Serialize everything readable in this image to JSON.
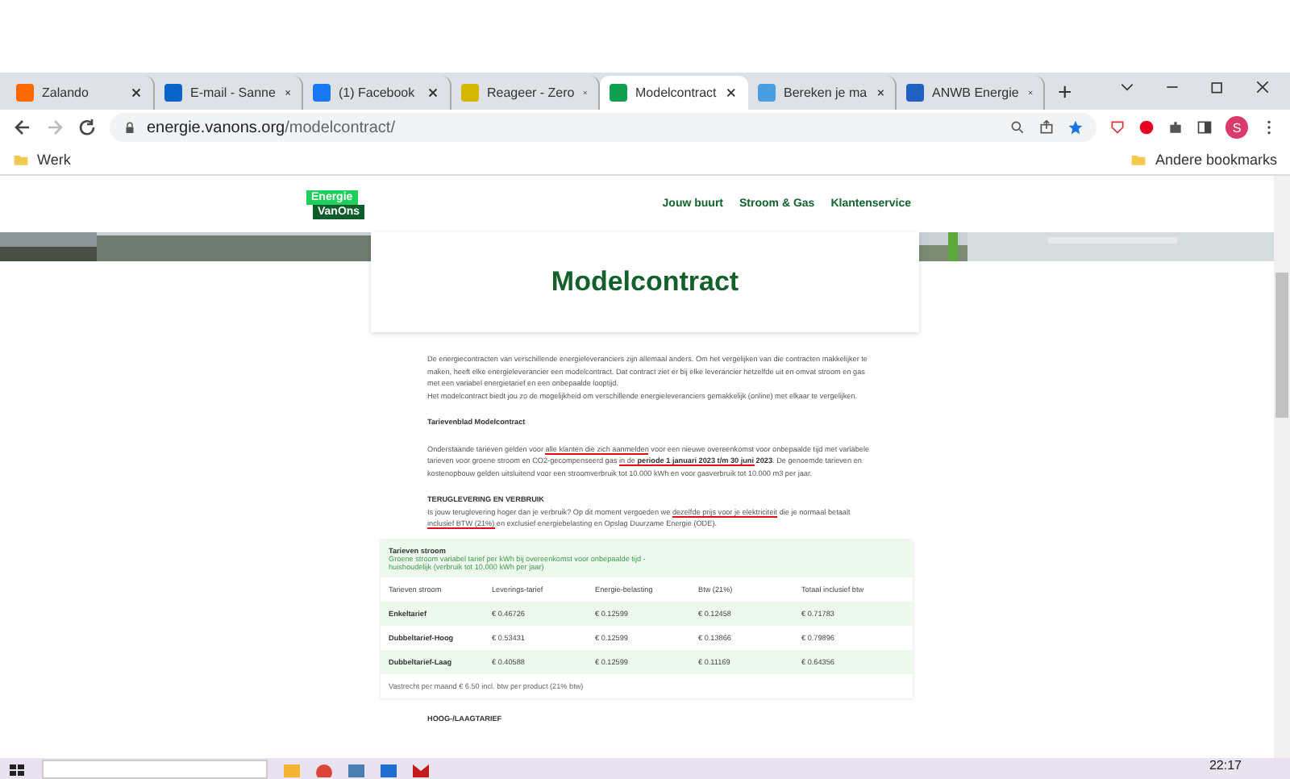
{
  "browser": {
    "tabs": [
      {
        "title": "Zalando",
        "selected": false,
        "color": "#ff6900"
      },
      {
        "title": "E-mail - Sanne",
        "selected": false,
        "color": "#0a64c8"
      },
      {
        "title": "(1) Facebook",
        "selected": false,
        "color": "#1877f2"
      },
      {
        "title": "Reageer - Zero",
        "selected": false,
        "color": "#d4b800"
      },
      {
        "title": "Modelcontract",
        "selected": true,
        "color": "#10a050"
      },
      {
        "title": "Bereken je ma",
        "selected": false,
        "color": "#4a9ee0"
      },
      {
        "title": "ANWB Energie",
        "selected": false,
        "color": "#2060c0"
      }
    ],
    "new_tab": "+",
    "url_host": "energie.vanons.org",
    "url_path": "/modelcontract/",
    "bookmarks": [
      "Werk"
    ],
    "other_bookmarks": "Andere bookmarks",
    "profile": "S"
  },
  "page": {
    "logo": {
      "top": "Energie",
      "bottom": "VanOns"
    },
    "nav": [
      "Jouw buurt",
      "Stroom & Gas",
      "Klantenservice"
    ],
    "title": "Modelcontract",
    "blocks": [
      {
        "kind": "paragraph",
        "segments": [
          {
            "text": "De energiecontracten van verschillende energieleveranciers zijn allemaal anders. Om het vergelijken van die contracten makkelijker te maken, heeft elke energieleverancier een modelcontract. Dat contract ziet er bij elke leverancier hetzelfde uit en omvat stroom en gas met een variabel energietarief en een onbepaalde looptijd.",
            "bold": false,
            "underlined": false
          }
        ]
      },
      {
        "kind": "continuation",
        "segments": [
          {
            "text": "Het modelcontract biedt jou zo de mogelijkheid om verschillende energieleveranciers gemakkelijk (online) met elkaar te vergelijken.",
            "bold": false,
            "underlined": false
          }
        ]
      },
      {
        "kind": "heading",
        "segments": [
          {
            "text": "Tarievenblad Modelcontract",
            "bold": true,
            "underlined": false
          }
        ]
      },
      {
        "kind": "paragraph",
        "segments": [
          {
            "text": "Onderstaande tarieven gelden voor ",
            "bold": false,
            "underlined": false
          },
          {
            "text": "alle klanten die zich aanmelden",
            "bold": false,
            "underlined": true
          },
          {
            "text": " voor een nieuwe overeenkomst voor onbepaalde tijd met variabele tarieven voor groene stroom en CO2-gecompenseerd gas ",
            "bold": false,
            "underlined": false
          },
          {
            "text": "in de ",
            "bold": false,
            "underlined": true
          },
          {
            "text": "periode 1 januari 2023 t/m 30 juni",
            "bold": true,
            "underlined": true
          },
          {
            "text": " 2023",
            "bold": true,
            "underlined": false
          },
          {
            "text": ". De genoemde tarieven en kostenopbouw gelden uitsluitend voor een stroomverbruik tot 10.000 kWh en voor gasverbruik tot 10.000 m3 per jaar.",
            "bold": false,
            "underlined": false
          }
        ]
      },
      {
        "kind": "heading",
        "segments": [
          {
            "text": "TERUGLEVERING EN VERBRUIK",
            "bold": true,
            "underlined": false
          }
        ]
      },
      {
        "kind": "continuation",
        "segments": [
          {
            "text": "Is jouw teruglevering hoger dan je verbruik? Op dit moment vergoeden we ",
            "bold": false,
            "underlined": false
          },
          {
            "text": "dezelfde prijs voor je elektriciteit",
            "bold": false,
            "underlined": true
          },
          {
            "text": " die je normaal betaalt ",
            "bold": false,
            "underlined": false
          },
          {
            "text": "inclusief BTW (21%)",
            "bold": false,
            "underlined": true
          },
          {
            "text": " en exclusief energiebelasting en Opslag Duurzame Energie (ODE).",
            "bold": false,
            "underlined": false
          }
        ]
      }
    ],
    "table": {
      "caption": "Tarieven stroom",
      "subtitle": "Groene stroom variabel tarief per kWh bij overeenkomst voor onbepaalde tijd - huishoudelijk (verbruik tot 10.000 kWh per jaar)",
      "columns": [
        "Tarieven stroom",
        "Leverings-tarief",
        "Energie-belasting",
        "Btw (21%)",
        "Totaal inclusief btw"
      ],
      "rows": [
        [
          "Enkeltarief",
          "€ 0.46726",
          "€ 0.12599",
          "€ 0.12458",
          "€ 0.71783"
        ],
        [
          "Dubbeltarief-Hoog",
          "€ 0.53431",
          "€ 0.12599",
          "€ 0.13866",
          "€ 0.79896"
        ],
        [
          "Dubbeltarief-Laag",
          "€ 0.40588",
          "€ 0.12599",
          "€ 0.11169",
          "€ 0.64356"
        ]
      ],
      "note": "Vastrecht per maand € 6.50 incl. btw per product (21% btw)"
    },
    "next_heading": "HOOG-/LAAGTARIEF"
  },
  "taskbar": {
    "clock": "22:17"
  }
}
